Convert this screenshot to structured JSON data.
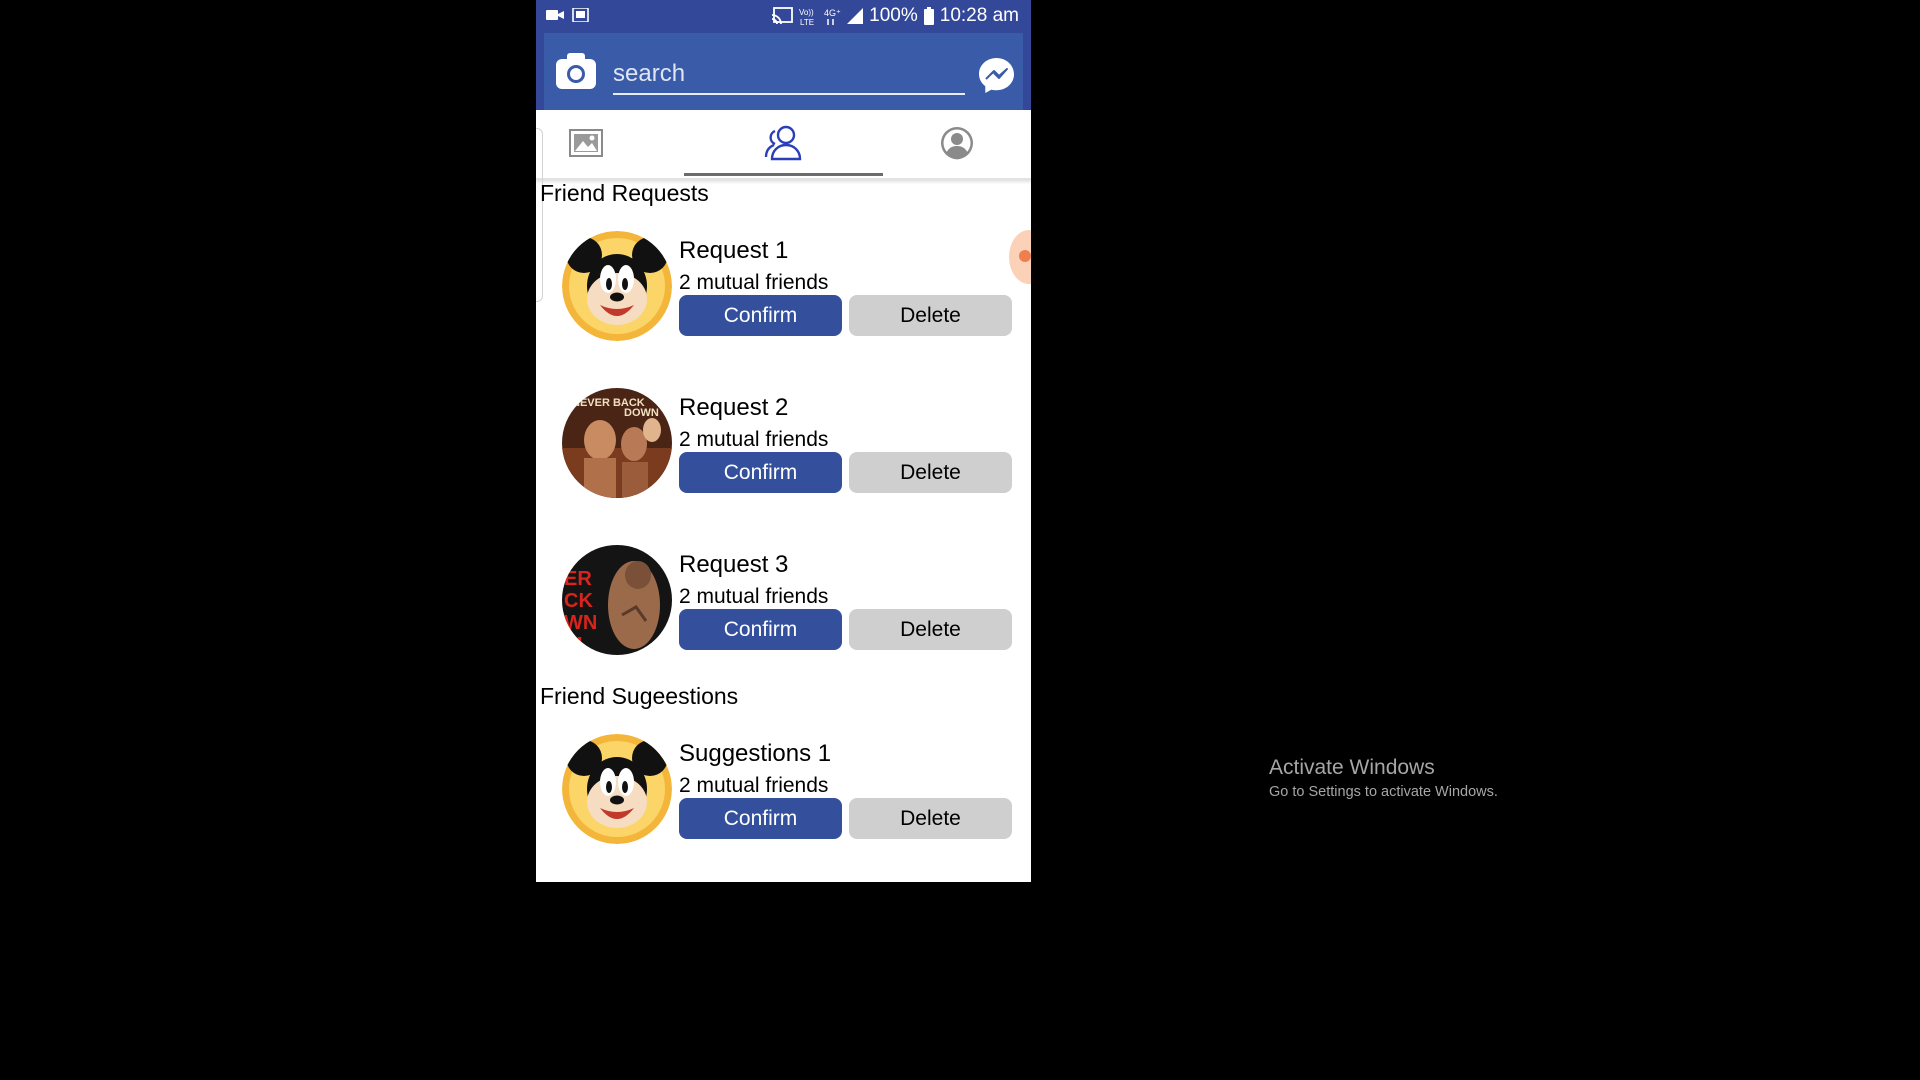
{
  "status_bar": {
    "battery": "100%",
    "time": "10:28 am",
    "icons": [
      "video-icon",
      "screenshot-icon",
      "cast-icon",
      "volte-icon",
      "4g-icon",
      "signal-icon",
      "battery-icon"
    ]
  },
  "header": {
    "search_placeholder": "search",
    "camera_icon": "camera-icon",
    "messenger_icon": "messenger-icon"
  },
  "tabs": [
    {
      "icon": "photo-icon",
      "selected": false
    },
    {
      "icon": "friends-icon",
      "selected": true
    },
    {
      "icon": "profile-icon",
      "selected": false
    }
  ],
  "colors": {
    "header_blue": "#3a5ba8",
    "status_blue": "#34489a",
    "confirm_blue": "#34509c",
    "delete_gray": "#cfcfcf"
  },
  "sections": {
    "requests_title": "Friend Requests",
    "suggestions_title": "Friend Sugeestions"
  },
  "requests": [
    {
      "name": "Request 1",
      "mutual": "2 mutual friends",
      "confirm": "Confirm",
      "delete": "Delete"
    },
    {
      "name": "Request 2",
      "mutual": "2 mutual friends",
      "confirm": "Confirm",
      "delete": "Delete"
    },
    {
      "name": "Request 3",
      "mutual": "2 mutual friends",
      "confirm": "Confirm",
      "delete": "Delete"
    }
  ],
  "suggestions": [
    {
      "name": "Suggestions 1",
      "mutual": "2 mutual friends",
      "confirm": "Confirm",
      "delete": "Delete"
    }
  ],
  "watermark": {
    "title": "Activate Windows",
    "subtitle": "Go to Settings to activate Windows."
  }
}
